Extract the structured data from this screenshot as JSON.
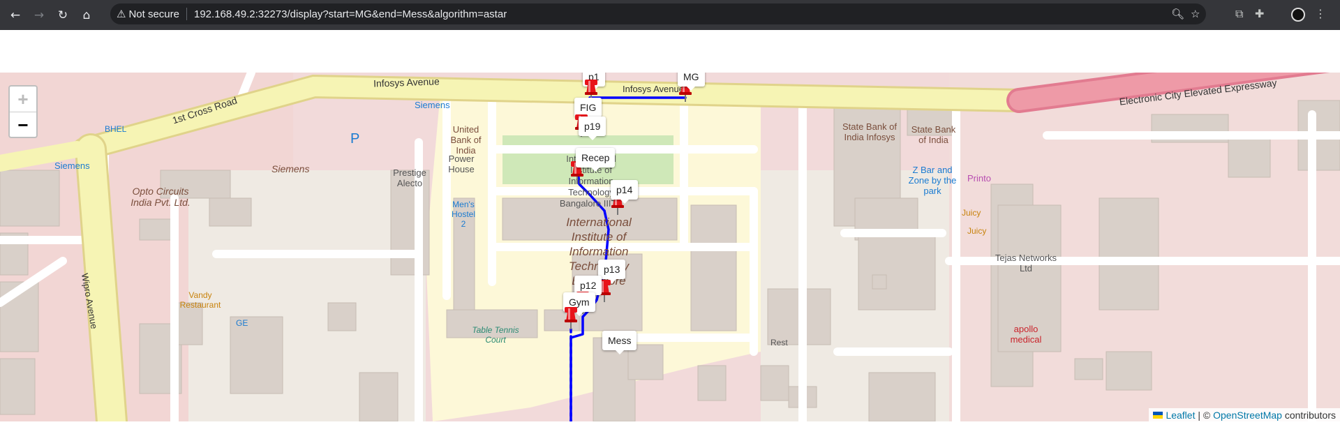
{
  "browser": {
    "security_label": "Not secure",
    "url": "192.168.49.2:32273/display?start=MG&end=Mess&algorithm=astar"
  },
  "map": {
    "zoom_in": "+",
    "zoom_out": "−",
    "attribution": {
      "leaflet": "Leaflet",
      "separator": " | © ",
      "osm": "OpenStreetMap",
      "suffix": " contributors"
    },
    "route_color": "#0000ff",
    "marker_color": "#e8141a",
    "waypoints": [
      {
        "id": "MG",
        "label": "MG"
      },
      {
        "id": "p1",
        "label": "p1"
      },
      {
        "id": "FIG",
        "label": "FIG"
      },
      {
        "id": "p19",
        "label": "p19"
      },
      {
        "id": "Recep",
        "label": "Recep"
      },
      {
        "id": "p14",
        "label": "p14"
      },
      {
        "id": "p13",
        "label": "p13"
      },
      {
        "id": "p12",
        "label": "p12"
      },
      {
        "id": "Gym",
        "label": "Gym"
      },
      {
        "id": "Mess",
        "label": "Mess"
      }
    ],
    "place_labels": {
      "infosys_avenue_1": "Infosys Avenue",
      "infosys_avenue_2": "Infosys Avenue",
      "first_cross_road": "1st Cross Road",
      "electronic_city": "Electronic City Elevated Expressway",
      "wipro_avenue": "Wipro Avenue",
      "siemens_1": "Siemens",
      "siemens_2": "Siemens",
      "siemens_3": "Siemens",
      "bhel": "BHEL",
      "opto": "Opto Circuits India Pvt. Ltd.",
      "prestige": "Prestige Alecto",
      "united_bank": "United Bank of India",
      "power_house": "Power House",
      "mens_hostel": "Men's Hostel 2",
      "iiitb_big": "International Institute of Information Technology Bangalore",
      "iiitb_small": "International Institute of Information Technology Bangalore IIITB",
      "sbi_1": "State Bank of India Infosys",
      "sbi_2": "State Bank of India",
      "zbar": "Z Bar and Zone by the park",
      "printo": "Printo",
      "juicy_1": "Juicy",
      "juicy_2": "Juicy",
      "tejas": "Tejas Networks Ltd",
      "apollo": "apollo medical",
      "vandy": "Vandy Restaurant",
      "ge": "GE",
      "table_tennis": "Table Tennis Court",
      "rest": "Rest",
      "parking": "P"
    }
  }
}
